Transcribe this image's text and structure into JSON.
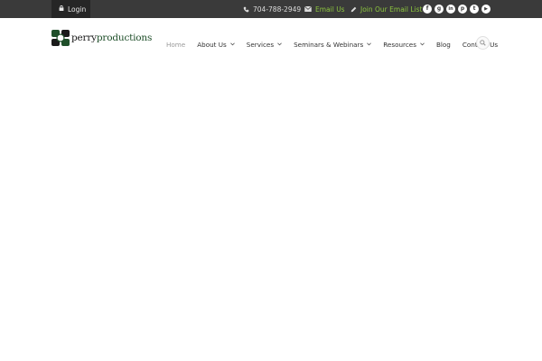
{
  "topbar": {
    "login_label": "Login",
    "phone": "704-788-2949",
    "email_label": "Email Us",
    "email_list_label": "Join Our Email List",
    "social": [
      {
        "icon": "facebook-icon",
        "glyph": "f"
      },
      {
        "icon": "google-plus-icon",
        "glyph": "g"
      },
      {
        "icon": "linkedin-icon",
        "glyph": "in"
      },
      {
        "icon": "pinterest-icon",
        "glyph": "p"
      },
      {
        "icon": "twitter-icon",
        "glyph": "t"
      },
      {
        "icon": "youtube-icon",
        "glyph": "▶"
      }
    ]
  },
  "logo": {
    "text_part1": "perry",
    "text_part2": "productions"
  },
  "nav": {
    "items": [
      {
        "label": "Home",
        "active": true,
        "dropdown": false
      },
      {
        "label": "About Us",
        "active": false,
        "dropdown": true
      },
      {
        "label": "Services",
        "active": false,
        "dropdown": true
      },
      {
        "label": "Seminars & Webinars",
        "active": false,
        "dropdown": true
      },
      {
        "label": "Resources",
        "active": false,
        "dropdown": true
      },
      {
        "label": "Blog",
        "active": false,
        "dropdown": false
      },
      {
        "label": "Contact Us",
        "active": false,
        "dropdown": false
      }
    ]
  },
  "colors": {
    "topbar_bg": "#3a3a3a",
    "accent_green": "#8dc63f",
    "logo_green": "#1f4f2a"
  }
}
